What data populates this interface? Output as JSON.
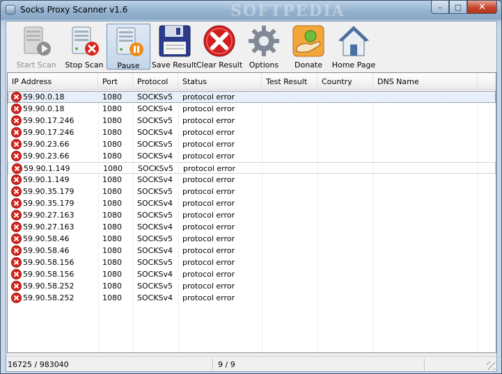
{
  "window": {
    "title": "Socks Proxy Scanner v1.6",
    "watermark": "SOFTPEDIA",
    "minimize": "–",
    "maximize": "□",
    "close": "✕"
  },
  "toolbar": {
    "start_scan": "Start Scan",
    "stop_scan": "Stop Scan",
    "pause": "Pause",
    "save_result": "Save Result",
    "clear_result": "Clear Result",
    "options": "Options",
    "donate": "Donate",
    "home_page": "Home Page"
  },
  "table": {
    "columns": [
      "IP Address",
      "Port",
      "Protocol",
      "Status",
      "Test Result",
      "Country",
      "DNS Name"
    ],
    "rows": [
      [
        "59.90.0.18",
        "1080",
        "SOCKSv5",
        "protocol error",
        "",
        "",
        ""
      ],
      [
        "59.90.0.18",
        "1080",
        "SOCKSv4",
        "protocol error",
        "",
        "",
        ""
      ],
      [
        "59.90.17.246",
        "1080",
        "SOCKSv5",
        "protocol error",
        "",
        "",
        ""
      ],
      [
        "59.90.17.246",
        "1080",
        "SOCKSv4",
        "protocol error",
        "",
        "",
        ""
      ],
      [
        "59.90.23.66",
        "1080",
        "SOCKSv5",
        "protocol error",
        "",
        "",
        ""
      ],
      [
        "59.90.23.66",
        "1080",
        "SOCKSv4",
        "protocol error",
        "",
        "",
        ""
      ],
      [
        "59.90.1.149",
        "1080",
        "SOCKSv5",
        "protocol error",
        "",
        "",
        ""
      ],
      [
        "59.90.1.149",
        "1080",
        "SOCKSv4",
        "protocol error",
        "",
        "",
        ""
      ],
      [
        "59.90.35.179",
        "1080",
        "SOCKSv5",
        "protocol error",
        "",
        "",
        ""
      ],
      [
        "59.90.35.179",
        "1080",
        "SOCKSv4",
        "protocol error",
        "",
        "",
        ""
      ],
      [
        "59.90.27.163",
        "1080",
        "SOCKSv5",
        "protocol error",
        "",
        "",
        ""
      ],
      [
        "59.90.27.163",
        "1080",
        "SOCKSv4",
        "protocol error",
        "",
        "",
        ""
      ],
      [
        "59.90.58.46",
        "1080",
        "SOCKSv5",
        "protocol error",
        "",
        "",
        ""
      ],
      [
        "59.90.58.46",
        "1080",
        "SOCKSv4",
        "protocol error",
        "",
        "",
        ""
      ],
      [
        "59.90.58.156",
        "1080",
        "SOCKSv5",
        "protocol error",
        "",
        "",
        ""
      ],
      [
        "59.90.58.156",
        "1080",
        "SOCKSv4",
        "protocol error",
        "",
        "",
        ""
      ],
      [
        "59.90.58.252",
        "1080",
        "SOCKSv5",
        "protocol error",
        "",
        "",
        ""
      ],
      [
        "59.90.58.252",
        "1080",
        "SOCKSv4",
        "protocol error",
        "",
        "",
        ""
      ]
    ],
    "row_icon": "error-icon"
  },
  "status": {
    "progress": "16725 / 983040",
    "threads": "9 / 9"
  },
  "colors": {
    "error_red": "#d9261c",
    "selection": "#e7f0fa"
  }
}
